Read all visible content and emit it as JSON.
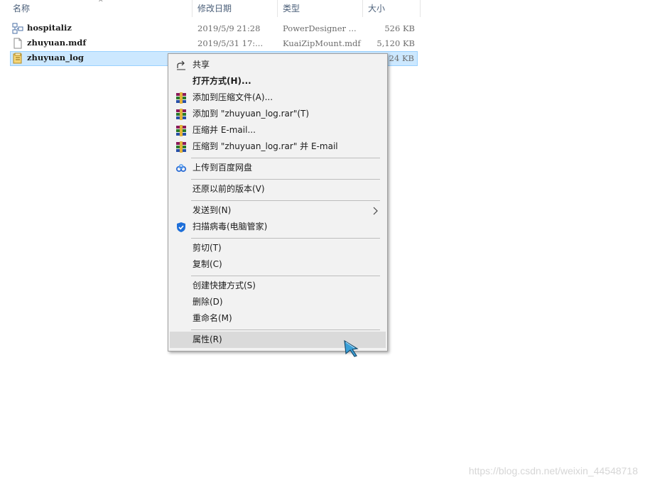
{
  "columns": {
    "name": "名称",
    "date": "修改日期",
    "type": "类型",
    "size": "大小"
  },
  "files": [
    {
      "name": "hospitaliz",
      "date": "2019/5/9 21:28",
      "type": "PowerDesigner ...",
      "size": "526 KB",
      "icon": "powerdesigner-file-icon"
    },
    {
      "name": "zhuyuan.mdf",
      "date": "2019/5/31 17:...",
      "type": "KuaiZipMount.mdf",
      "size": "5,120 KB",
      "icon": "blank-file-icon"
    },
    {
      "name": "zhuyuan_log",
      "date": "",
      "type": "",
      "size": "24 KB",
      "icon": "database-file-icon"
    }
  ],
  "context_menu": {
    "share": "共享",
    "open_with": "打开方式(H)...",
    "add_to_archive": "添加到压缩文件(A)...",
    "add_to_rar": "添加到 \"zhuyuan_log.rar\"(T)",
    "compress_email": "压缩并 E-mail...",
    "compress_rar_email": "压缩到 \"zhuyuan_log.rar\" 并 E-mail",
    "upload_baidu": "上传到百度网盘",
    "restore_versions": "还原以前的版本(V)",
    "send_to": "发送到(N)",
    "scan_virus": "扫描病毒(电脑管家)",
    "cut": "剪切(T)",
    "copy": "复制(C)",
    "create_shortcut": "创建快捷方式(S)",
    "delete": "删除(D)",
    "rename": "重命名(M)",
    "properties": "属性(R)"
  },
  "watermark": "https://blog.csdn.net/weixin_44548718",
  "colors": {
    "selection": "#cce8ff",
    "menu_bg": "#f2f2f2",
    "hover": "#dadada"
  }
}
